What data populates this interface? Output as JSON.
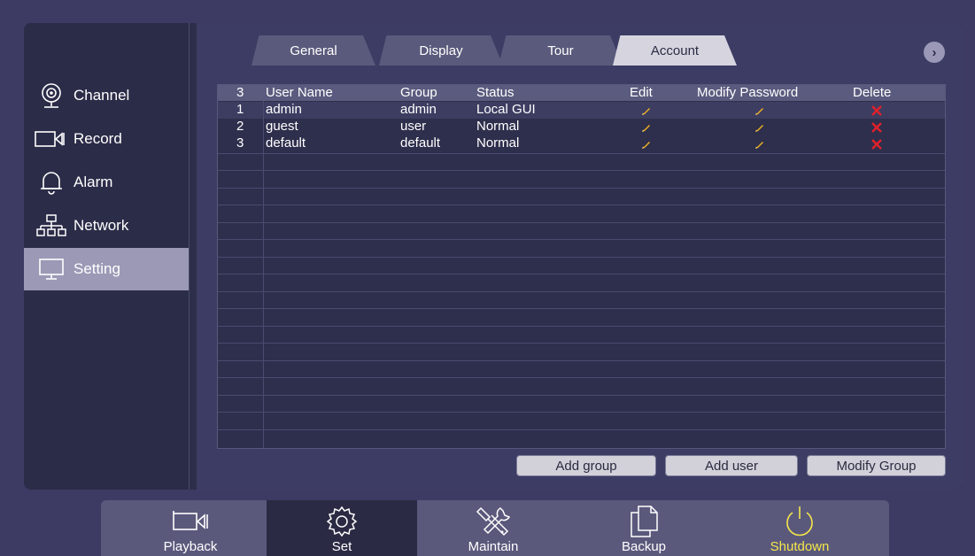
{
  "sidebar": {
    "items": [
      {
        "label": "Channel",
        "icon": "camera-icon"
      },
      {
        "label": "Record",
        "icon": "record-icon"
      },
      {
        "label": "Alarm",
        "icon": "bell-icon"
      },
      {
        "label": "Network",
        "icon": "network-icon"
      },
      {
        "label": "Setting",
        "icon": "monitor-icon",
        "active": true
      }
    ]
  },
  "tabs": [
    {
      "label": "General"
    },
    {
      "label": "Display"
    },
    {
      "label": "Tour"
    },
    {
      "label": "Account",
      "active": true
    }
  ],
  "next_icon": "chevron-right-icon",
  "table": {
    "headers": {
      "count": "3",
      "user_name": "User Name",
      "group": "Group",
      "status": "Status",
      "edit": "Edit",
      "modify_password": "Modify Password",
      "delete": "Delete"
    },
    "rows": [
      {
        "num": "1",
        "user_name": "admin",
        "group": "admin",
        "status": "Local GUI"
      },
      {
        "num": "2",
        "user_name": "guest",
        "group": "user",
        "status": "Normal"
      },
      {
        "num": "3",
        "user_name": "default",
        "group": "default",
        "status": "Normal"
      }
    ]
  },
  "buttons": {
    "add_group": "Add group",
    "add_user": "Add user",
    "modify_group": "Modify Group"
  },
  "bottombar": {
    "items": [
      {
        "label": "Playback",
        "icon": "playback-camera-icon"
      },
      {
        "label": "Set",
        "icon": "gear-icon",
        "active": true
      },
      {
        "label": "Maintain",
        "icon": "tools-icon"
      },
      {
        "label": "Backup",
        "icon": "copy-icon"
      },
      {
        "label": "Shutdown",
        "icon": "power-icon"
      }
    ]
  },
  "colors": {
    "accent_active_tab": "#d6d5df",
    "shutdown": "#f5e64a",
    "edit_icon": "#f0b020",
    "delete_icon": "#e0212a"
  }
}
